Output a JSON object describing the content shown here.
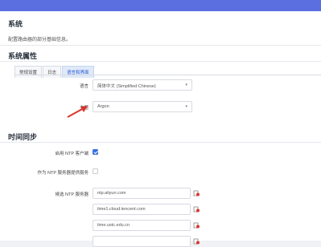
{
  "colors": {
    "accent": "#5c6fe0",
    "link": "#2a5bd7",
    "danger": "#d9352b"
  },
  "system": {
    "title": "系统",
    "description": "配置路由器的部分基础信息。"
  },
  "properties": {
    "title": "系统属性",
    "tabs": [
      {
        "label": "常规设置",
        "active": false
      },
      {
        "label": "日志",
        "active": false
      },
      {
        "label": "语言和界面",
        "active": true
      }
    ],
    "language_label": "语言",
    "language_value": "简体中文 (Simplified Chinese)",
    "theme_label": "主题",
    "theme_value": "Argon"
  },
  "time_sync": {
    "title": "时间同步",
    "ntp_client_label": "启用 NTP 客户端",
    "ntp_client_checked": true,
    "ntp_server_label": "作为 NTP 服务器提供服务",
    "ntp_server_checked": false,
    "candidates_label": "候选 NTP 服务器",
    "servers": [
      "ntp.aliyun.com",
      "time1.cloud.tencent.com",
      "time.ustc.edu.cn"
    ]
  }
}
